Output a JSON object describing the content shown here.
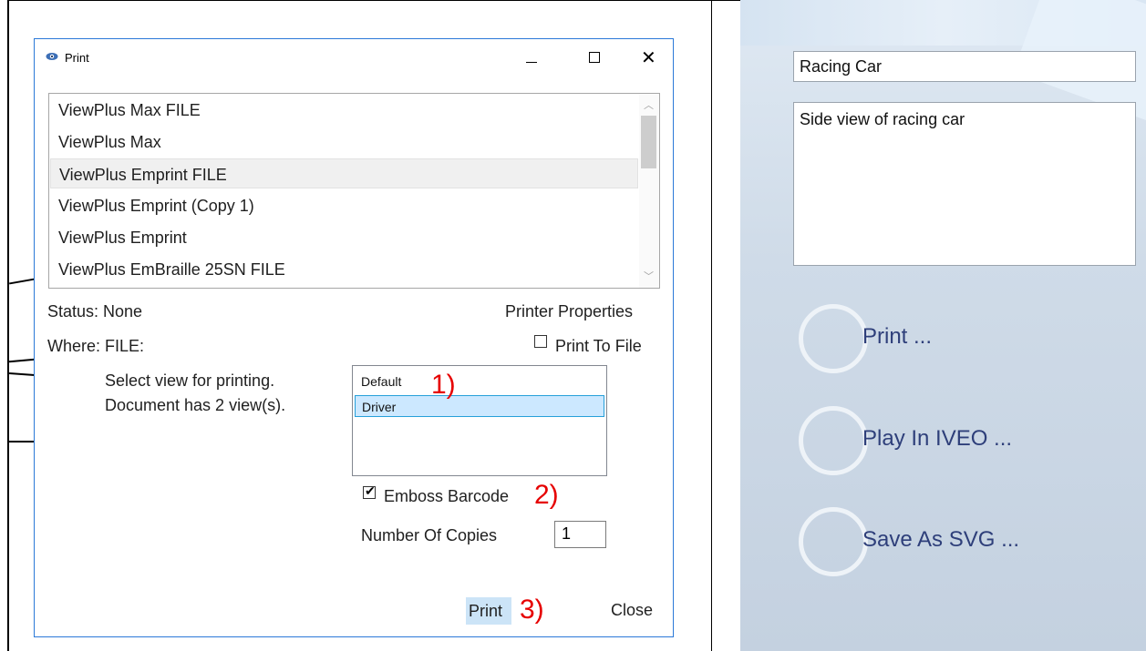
{
  "dialog": {
    "title": "Print",
    "window_controls": {
      "minimize": "minimize",
      "maximize": "maximize",
      "close": "✕"
    },
    "printers": [
      {
        "label": "ViewPlus Max FILE"
      },
      {
        "label": "ViewPlus Max"
      },
      {
        "label": "ViewPlus Emprint FILE",
        "selected": true
      },
      {
        "label": "ViewPlus Emprint (Copy 1)"
      },
      {
        "label": "ViewPlus Emprint"
      },
      {
        "label": "ViewPlus EmBraille 25SN FILE"
      }
    ],
    "status_text": "Status: None",
    "where_text": "Where: FILE:",
    "printer_properties": "Printer Properties",
    "print_to_file_label": "Print To File",
    "print_to_file_checked": false,
    "select_view_line1": "Select view for printing.",
    "select_view_line2": "Document has 2 view(s).",
    "views": [
      {
        "label": "Default"
      },
      {
        "label": "Driver",
        "selected": true
      }
    ],
    "emboss_barcode_label": "Emboss Barcode",
    "emboss_barcode_checked": true,
    "copies_label": "Number Of Copies",
    "copies_value": "1",
    "print_button": "Print",
    "close_button": "Close"
  },
  "annotations": {
    "a1": "1)",
    "a2": "2)",
    "a3": "3)"
  },
  "right_panel": {
    "title_value": "Racing Car",
    "description_value": "Side view of racing car",
    "actions": [
      {
        "label": "Print ..."
      },
      {
        "label": "Play In IVEO ..."
      },
      {
        "label": "Save As SVG ..."
      }
    ]
  },
  "colors": {
    "dialog_border": "#2b79d8",
    "annotation": "#e60000",
    "action_text": "#2e3f7a",
    "selection": "#cce8ff"
  }
}
